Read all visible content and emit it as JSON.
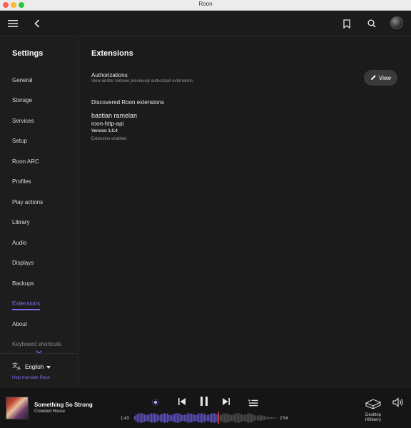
{
  "window": {
    "title": "Roon"
  },
  "topbar": {
    "menu_icon": "hamburger-menu-icon",
    "back_icon": "chevron-left-icon",
    "bookmark_icon": "bookmark-icon",
    "search_icon": "search-icon",
    "avatar_icon": "profile-avatar"
  },
  "sidebar": {
    "title": "Settings",
    "items": [
      {
        "label": "General"
      },
      {
        "label": "Storage"
      },
      {
        "label": "Services"
      },
      {
        "label": "Setup"
      },
      {
        "label": "Roon ARC"
      },
      {
        "label": "Profiles"
      },
      {
        "label": "Play actions"
      },
      {
        "label": "Library"
      },
      {
        "label": "Audio"
      },
      {
        "label": "Displays"
      },
      {
        "label": "Backups"
      },
      {
        "label": "Extensions"
      },
      {
        "label": "About"
      },
      {
        "label": "Keyboard shortcuts"
      }
    ],
    "active_item": "Extensions",
    "language": "English",
    "help_link": "Help translate Roon"
  },
  "main": {
    "title": "Extensions",
    "authorizations": {
      "title": "Authorizations",
      "subtitle": "View and/or remove previously authorized extensions.",
      "button_label": "View"
    },
    "discovered_title": "Discovered Roon extensions",
    "extension": {
      "author": "bastian ramelan",
      "name": "roon-http-api",
      "version": "Version 1.0.4",
      "status": "Extension enabled"
    }
  },
  "player": {
    "track_title": "Something So Strong",
    "artist": "Crowded House",
    "elapsed": "1:43",
    "total": "2:54",
    "progress": 0.59,
    "zone": {
      "line1": "Desktop",
      "line2": "Hifiberry"
    }
  },
  "colors": {
    "accent": "#7c6ff0",
    "background": "#1b1b1b",
    "waveform_played": "#5a4fb8",
    "waveform_remaining": "#4a4a4a",
    "playhead": "#e0413c"
  }
}
